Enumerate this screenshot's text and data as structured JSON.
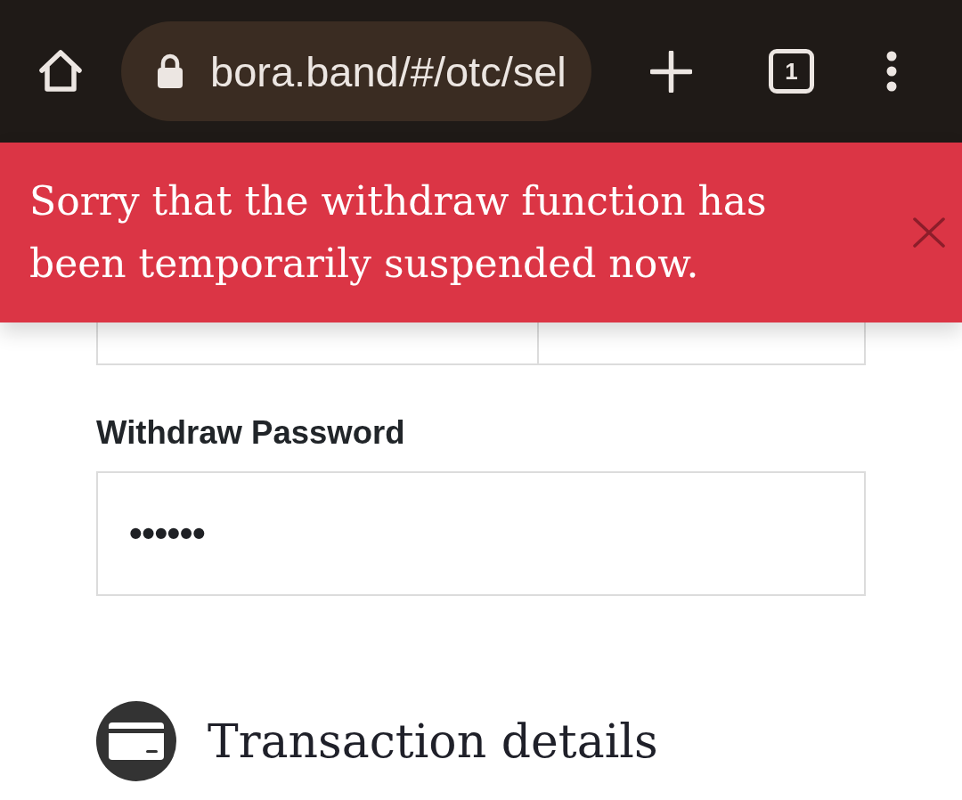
{
  "browser": {
    "url": "bora.band/#/otc/sel",
    "secure": true,
    "tab_count": "1"
  },
  "alert": {
    "message": "Sorry that the withdraw function has been temporarily suspended now.",
    "dismissible": true
  },
  "form": {
    "partial_fields": [
      {
        "kind": "input"
      },
      {
        "kind": "input"
      }
    ],
    "password": {
      "label": "Withdraw Password",
      "value": "••••••"
    }
  },
  "section": {
    "title": "Transaction details"
  }
}
